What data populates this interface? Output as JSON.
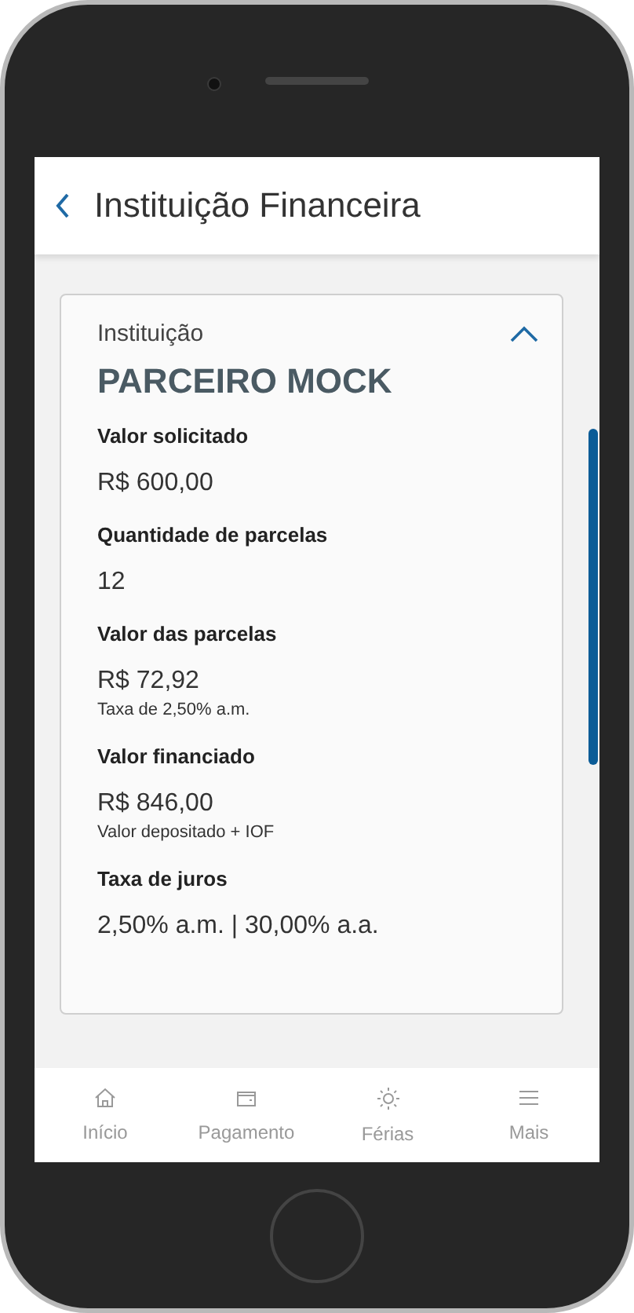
{
  "header": {
    "title": "Instituição Financeira"
  },
  "card": {
    "heading": "Instituição",
    "expanded": true,
    "institution": "PARCEIRO MOCK",
    "fields": [
      {
        "label": "Valor solicitado",
        "value": "R$ 600,00"
      },
      {
        "label": "Quantidade de parcelas",
        "value": "12"
      },
      {
        "label": "Valor das parcelas",
        "value": "R$ 72,92",
        "note": "Taxa de 2,50% a.m."
      },
      {
        "label": "Valor financiado",
        "value": "R$ 846,00",
        "note": "Valor depositado + IOF"
      },
      {
        "label": "Taxa de juros",
        "value": "2,50% a.m. | 30,00% a.a."
      }
    ]
  },
  "tab_bar": [
    {
      "kind": "home",
      "label": "Início"
    },
    {
      "kind": "wallet",
      "label": "Pagamento"
    },
    {
      "kind": "sun",
      "label": "Férias"
    },
    {
      "kind": "menu",
      "label": "Mais"
    }
  ]
}
